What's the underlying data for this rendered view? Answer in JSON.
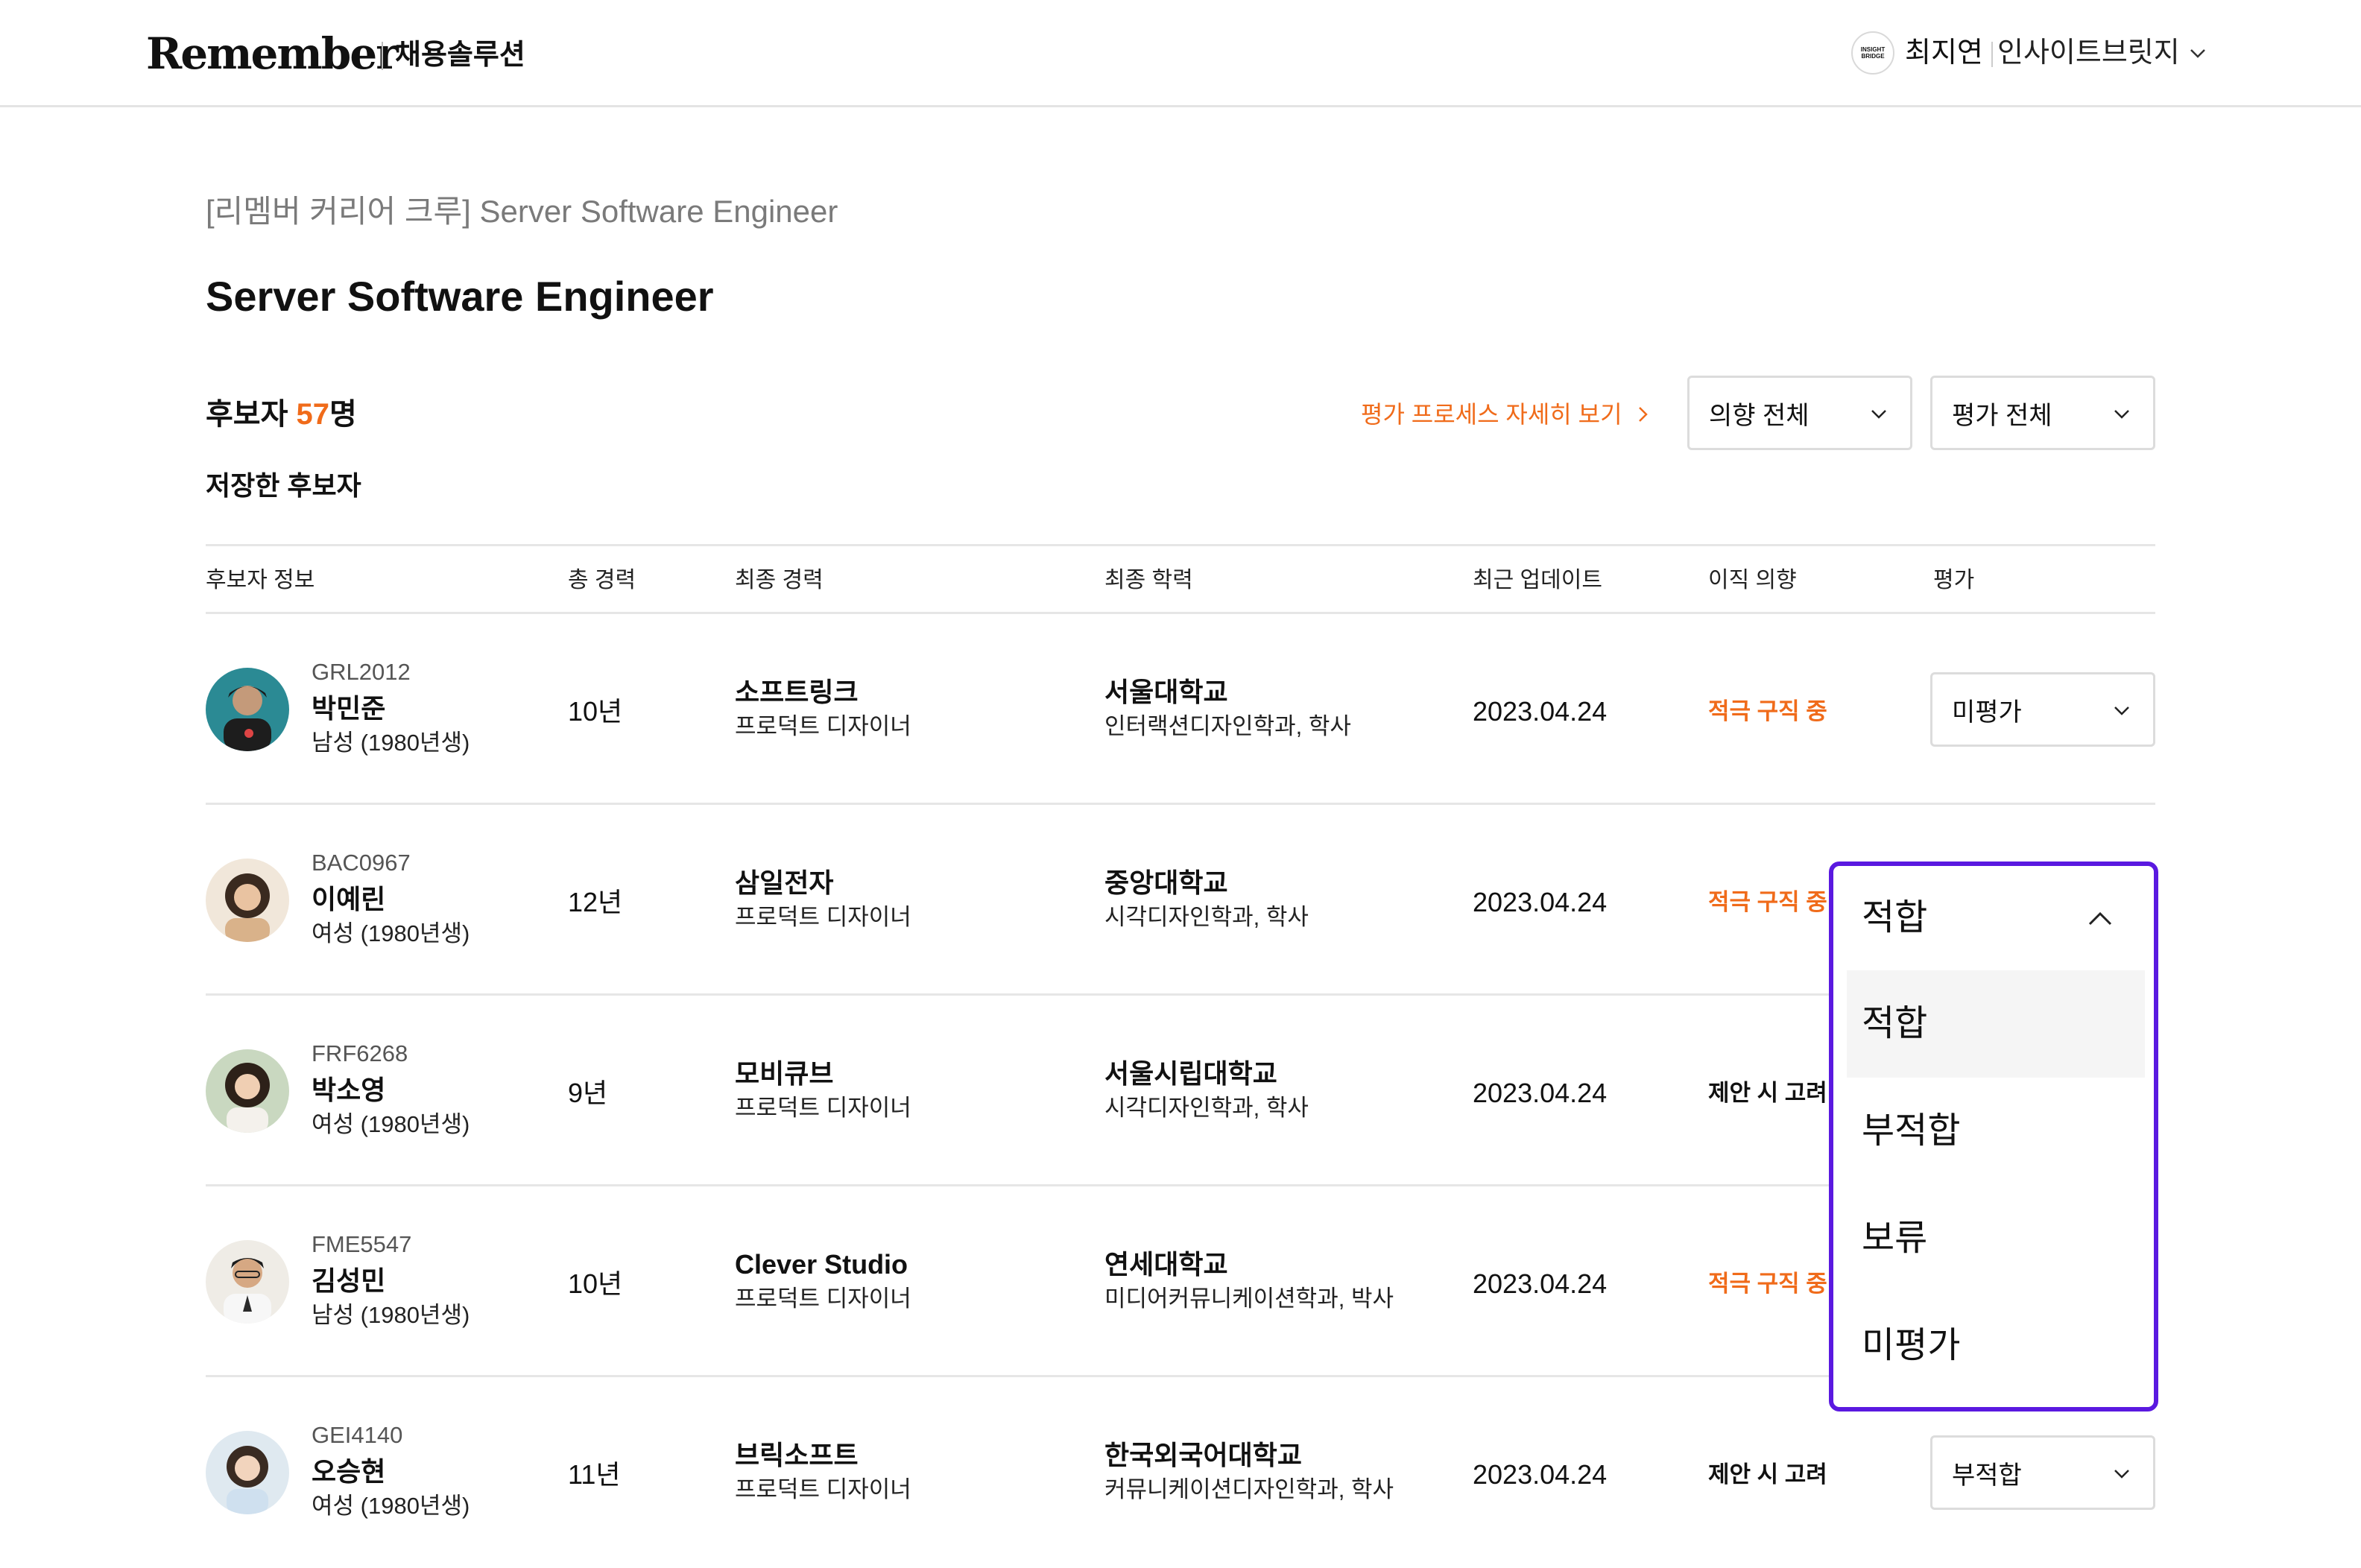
{
  "header": {
    "logo": "Remember",
    "logo_sub": "채용솔루션",
    "org_logo_text": "INSIGHT BRIDGE",
    "user_name": "최지연",
    "org_name": "인사이트브릿지"
  },
  "page": {
    "breadcrumb": "[리멤버 커리어 크루] Server Software Engineer",
    "title": "Server Software Engineer"
  },
  "summary": {
    "count_prefix": "후보자 ",
    "count": "57",
    "count_suffix": "명",
    "saved_tab": "저장한 후보자",
    "process_link": "평가 프로세스 자세히 보기",
    "intent_filter": "의향 전체",
    "eval_filter": "평가 전체"
  },
  "table": {
    "columns": [
      "후보자 정보",
      "총 경력",
      "최종 경력",
      "최종 학력",
      "최근 업데이트",
      "이직 의향",
      "평가"
    ],
    "rows": [
      {
        "id": "GRL2012",
        "name": "박민준",
        "info": "남성 (1980년생)",
        "years": "10년",
        "company": "소프트링크",
        "role": "프로덕트 디자이너",
        "school": "서울대학교",
        "major": "인터랙션디자인학과, 학사",
        "updated": "2023.04.24",
        "intent": "적극 구직 중",
        "evaluation": "미평가"
      },
      {
        "id": "BAC0967",
        "name": "이예린",
        "info": "여성 (1980년생)",
        "years": "12년",
        "company": "삼일전자",
        "role": "프로덕트 디자이너",
        "school": "중앙대학교",
        "major": "시각디자인학과, 학사",
        "updated": "2023.04.24",
        "intent": "적극 구직 중",
        "evaluation": "적합"
      },
      {
        "id": "FRF6268",
        "name": "박소영",
        "info": "여성 (1980년생)",
        "years": "9년",
        "company": "모비큐브",
        "role": "프로덕트 디자이너",
        "school": "서울시립대학교",
        "major": "시각디자인학과, 학사",
        "updated": "2023.04.24",
        "intent": "제안 시 고려",
        "evaluation": ""
      },
      {
        "id": "FME5547",
        "name": "김성민",
        "info": "남성 (1980년생)",
        "years": "10년",
        "company": "Clever Studio",
        "role": "프로덕트 디자이너",
        "school": "연세대학교",
        "major": "미디어커뮤니케이션학과, 박사",
        "updated": "2023.04.24",
        "intent": "적극 구직 중",
        "evaluation": ""
      },
      {
        "id": "GEI4140",
        "name": "오승현",
        "info": "여성 (1980년생)",
        "years": "11년",
        "company": "브릭소프트",
        "role": "프로덕트 디자이너",
        "school": "한국외국어대학교",
        "major": "커뮤니케이션디자인학과, 학사",
        "updated": "2023.04.24",
        "intent": "제안 시 고려",
        "evaluation": "부적합"
      }
    ]
  },
  "dropdown": {
    "selected": "적합",
    "options": [
      "적합",
      "부적합",
      "보류",
      "미평가"
    ]
  },
  "colors": {
    "accent": "#f06b1a",
    "dropdown_border": "#5a19e0",
    "divider": "#e6e6e6"
  },
  "icons": {
    "chevron_down": "chevron-down-icon",
    "chevron_up": "chevron-up-icon",
    "chevron_right": "chevron-right-icon"
  }
}
